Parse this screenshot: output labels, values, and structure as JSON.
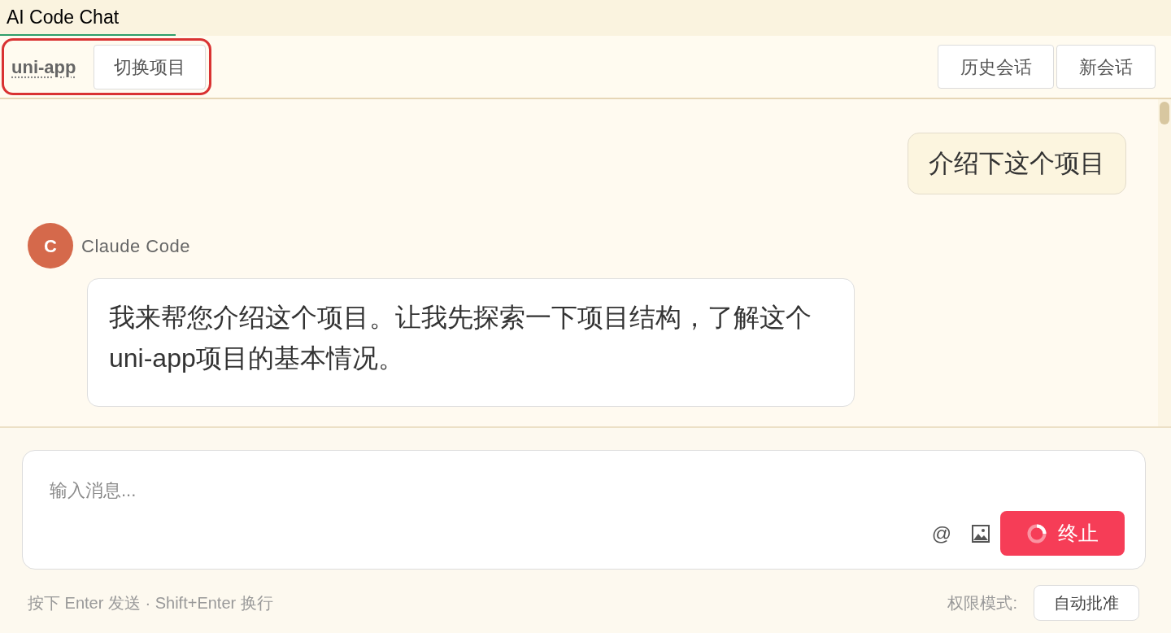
{
  "tabs": [
    {
      "label": "AI Code Chat",
      "selected": true
    }
  ],
  "header": {
    "project": {
      "name": "uni-app",
      "highlighted": true
    },
    "switch_button": "切换项目",
    "actions": [
      "历史会话",
      "新会话"
    ]
  },
  "messages": [
    {
      "kind": "user",
      "text": "介绍下这个项目"
    },
    {
      "kind": "assistant",
      "avatar": "C",
      "author": "Claude Code",
      "text": "我来帮您介绍这个项目。让我先探索一下项目结构，了解这个uni-app项目的基本情况。"
    }
  ],
  "composer": {
    "placeholder": "输入消息...",
    "mention_button": "@",
    "stop_button": {
      "label": "终止",
      "loading": true
    }
  },
  "footer": {
    "hint": "按下 Enter 发送 · Shift+Enter 换行",
    "permission_label": "权限模式:",
    "permission_mode": "自动批准"
  }
}
